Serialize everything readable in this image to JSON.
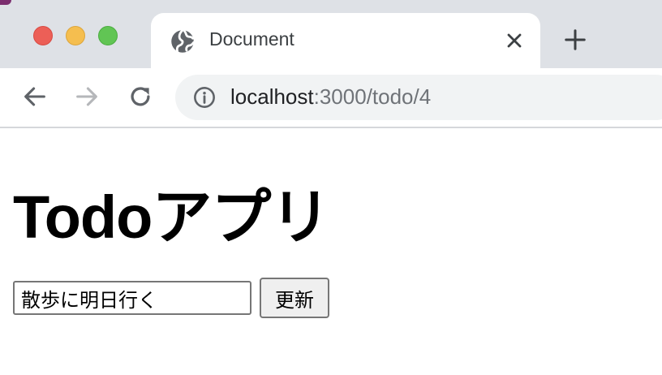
{
  "browser": {
    "tab": {
      "title": "Document",
      "favicon": "globe-icon",
      "close_icon": "close-icon"
    },
    "new_tab_icon": "plus-icon",
    "nav": {
      "back_icon": "arrow-left-icon",
      "forward_icon": "arrow-right-icon",
      "reload_icon": "reload-icon"
    },
    "address_bar": {
      "info_icon": "info-icon",
      "host": "localhost",
      "path": ":3000/todo/4"
    },
    "traffic_lights": {
      "close_color": "#ec5f57",
      "minimize_color": "#f5be4f",
      "zoom_color": "#61c554"
    }
  },
  "page": {
    "heading": "Todoアプリ",
    "todo_input_value": "散歩に明日行く",
    "update_button_label": "更新"
  }
}
